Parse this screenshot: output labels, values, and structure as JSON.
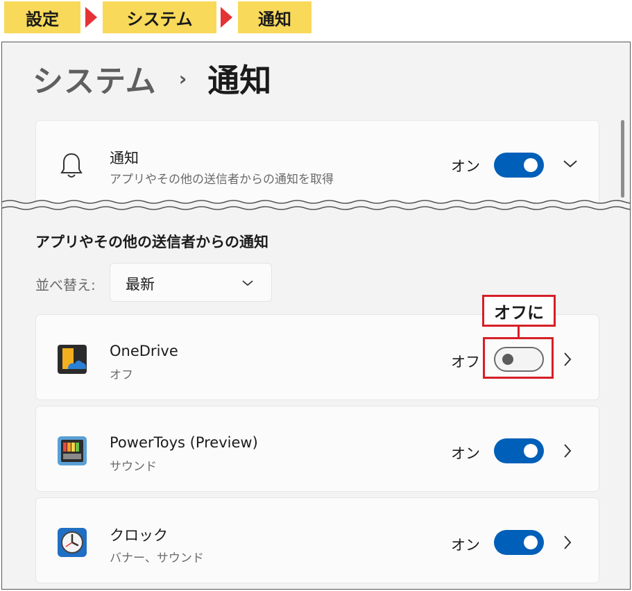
{
  "breadcrumb": {
    "items": [
      "設定",
      "システム",
      "通知"
    ],
    "arrow_color": "#e53335",
    "chip_color": "#f8d95a"
  },
  "window": {
    "title_parent": "システム",
    "title_separator": "›",
    "title_current": "通知"
  },
  "notifications": {
    "icon": "bell-icon",
    "name": "通知",
    "description": "アプリやその他の送信者からの通知を取得",
    "state": "オン",
    "toggle_on": true
  },
  "section": {
    "title": "アプリやその他の送信者からの通知",
    "sort_label": "並べ替え:",
    "sort_value": "最新"
  },
  "apps": [
    {
      "icon": "onedrive-icon",
      "name": "OneDrive",
      "sub": "オフ",
      "state": "オフ",
      "toggle_on": false
    },
    {
      "icon": "powertoys-icon",
      "name": "PowerToys (Preview)",
      "sub": "サウンド",
      "state": "オン",
      "toggle_on": true
    },
    {
      "icon": "clock-icon",
      "name": "クロック",
      "sub": "バナー、サウンド",
      "state": "オン",
      "toggle_on": true
    }
  ],
  "annotation": {
    "label": "オフに",
    "color": "#d51f26"
  },
  "colors": {
    "accent": "#005fb8",
    "window_bg": "#f3f3f3",
    "card_bg": "#fbfbfb"
  }
}
